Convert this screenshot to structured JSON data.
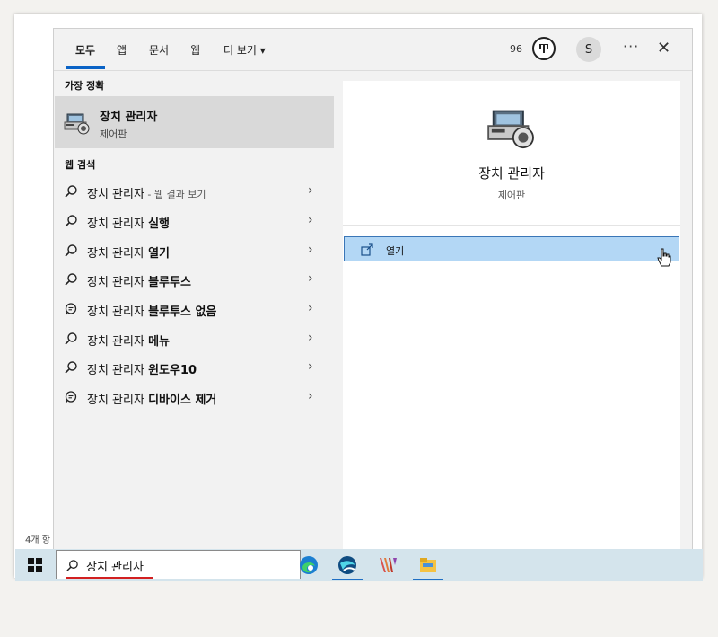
{
  "background": {
    "status_text": "4개 항"
  },
  "header": {
    "tabs": [
      {
        "label": "모두",
        "active": true
      },
      {
        "label": "앱",
        "active": false
      },
      {
        "label": "문서",
        "active": false
      },
      {
        "label": "웹",
        "active": false
      },
      {
        "label": "더 보기 ▾",
        "active": false
      }
    ],
    "points": "96",
    "avatar_letter": "S",
    "more_label": "···",
    "close_label": "✕"
  },
  "left": {
    "best_match_heading": "가장 정확",
    "best_match": {
      "title": "장치 관리자",
      "subtitle": "제어판",
      "icon": "device-manager-icon"
    },
    "web_heading": "웹 검색",
    "web_results": [
      {
        "prefix": "장치 관리자",
        "bold": "",
        "suffix": " - 웹 결과 보기",
        "icon": "search-icon"
      },
      {
        "prefix": "장치 관리자 ",
        "bold": "실행",
        "suffix": "",
        "icon": "search-icon"
      },
      {
        "prefix": "장치 관리자 ",
        "bold": "열기",
        "suffix": "",
        "icon": "search-icon"
      },
      {
        "prefix": "장치 관리자 ",
        "bold": "블루투스",
        "suffix": "",
        "icon": "search-icon"
      },
      {
        "prefix": "장치 관리자 ",
        "bold": "블루투스 없음",
        "suffix": "",
        "icon": "chat-search-icon"
      },
      {
        "prefix": "장치 관리자 ",
        "bold": "메뉴",
        "suffix": "",
        "icon": "search-icon"
      },
      {
        "prefix": "장치 관리자 ",
        "bold": "윈도우10",
        "suffix": "",
        "icon": "search-icon"
      },
      {
        "prefix": "장치 관리자 ",
        "bold": "디바이스 제거",
        "suffix": "",
        "icon": "chat-search-icon"
      }
    ],
    "chevron": "›"
  },
  "right": {
    "title": "장치 관리자",
    "subtitle": "제어판",
    "open_label": "열기"
  },
  "taskbar": {
    "search_value": "장치 관리자",
    "apps": [
      "edge-icon",
      "browser-app-icon",
      "app-icon",
      "file-explorer-icon"
    ]
  },
  "colors": {
    "accent": "#0a63c6",
    "selected": "#b3d7f5",
    "taskbar": "#d4e4ec",
    "highlight_underline": "#d22020"
  }
}
